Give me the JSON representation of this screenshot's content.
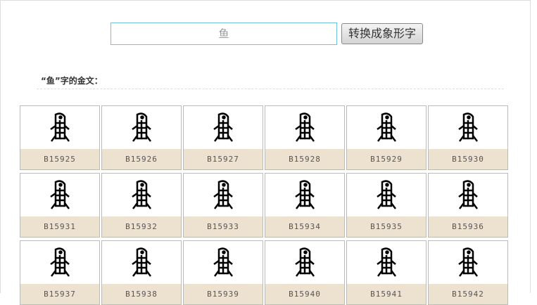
{
  "search": {
    "value": "鱼"
  },
  "convert_button": "转换成象形字",
  "section_title": "“鱼”字的金文：",
  "glyphs": [
    "B15925",
    "B15926",
    "B15927",
    "B15928",
    "B15929",
    "B15930",
    "B15931",
    "B15932",
    "B15933",
    "B15934",
    "B15935",
    "B15936",
    "B15937",
    "B15938",
    "B15939",
    "B15940",
    "B15941",
    "B15942"
  ]
}
